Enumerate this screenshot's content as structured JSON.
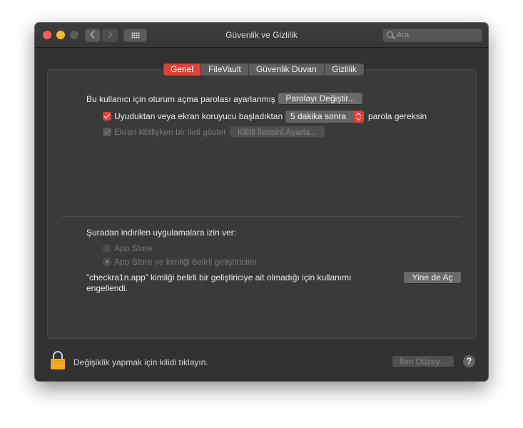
{
  "window": {
    "title": "Güvenlik ve Gizlilik"
  },
  "search": {
    "placeholder": "Ara"
  },
  "tabs": [
    {
      "label": "Genel",
      "active": true
    },
    {
      "label": "FileVault",
      "active": false
    },
    {
      "label": "Güvenlik Duvarı",
      "active": false
    },
    {
      "label": "Gizlilik",
      "active": false
    }
  ],
  "general": {
    "password_text": "Bu kullanıcı için oturum açma parolası ayarlanmış",
    "change_password_button": "Parolayı Değiştir...",
    "require_password": {
      "checked": true,
      "label_before": "Uyuduktan veya ekran koruyucu başladıktan",
      "select_value": "5 dakika sonra",
      "label_after": "parola gereksin"
    },
    "show_message": {
      "checked": true,
      "enabled": false,
      "label": "Ekran kilitliyken bir ileti göster",
      "button": "Kilitli İletisini Ayarla..."
    }
  },
  "downloads": {
    "heading": "Şuradan indirilen uygulamalara izin ver:",
    "options": [
      {
        "label": "App Store",
        "selected": false
      },
      {
        "label": "App Store ve kimliği belirli geliştiriciler",
        "selected": true
      }
    ],
    "blocked_line1": "”checkra1n.app” kimliği belirli bir geliştiriciye ait olmadığı için kullanımı",
    "blocked_line2": "engellendi.",
    "open_anyway_button": "Yine de Aç"
  },
  "footer": {
    "lock_text": "Değişiklik yapmak için kilidi tıklayın.",
    "advanced_button": "İleri Düzey...",
    "help_label": "?"
  },
  "colors": {
    "accent": "#dd4339",
    "window_bg": "#323232",
    "panel_bg": "#3a3a3a"
  }
}
